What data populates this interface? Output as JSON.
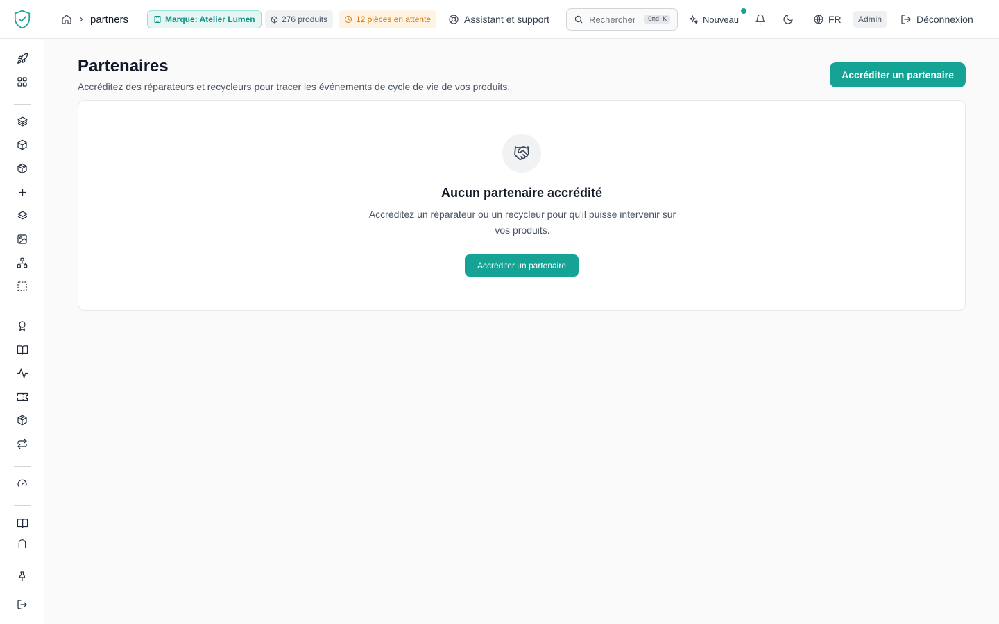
{
  "app": {
    "accent": "#14a394",
    "logo_icon": "shield-check-icon"
  },
  "header": {
    "breadcrumb": {
      "home_icon": "home-icon",
      "separator_icon": "chevron-right-icon",
      "current": "partners"
    },
    "brand_pill": {
      "label": "Marque: Atelier Lumen",
      "icon": "building-icon"
    },
    "products_pill": {
      "label": "276 produits",
      "icon": "box-icon"
    },
    "pending_pill": {
      "label": "12 pièces en attente",
      "icon": "clock-icon"
    },
    "support": {
      "label": "Assistant et support",
      "icon": "lifebuoy-icon"
    },
    "search": {
      "placeholder": "Rechercher",
      "shortcut": "Cmd K"
    },
    "new": {
      "label": "Nouveau",
      "icon": "sparkles-icon"
    },
    "notifications_icon": "bell-icon",
    "theme_icon": "moon-icon",
    "language": {
      "label": "FR",
      "icon": "globe-icon"
    },
    "role": "Admin",
    "logout": {
      "label": "Déconnexion",
      "icon": "logout-icon"
    }
  },
  "sidebar": {
    "icons": [
      "rocket-icon",
      "dashboard-icon",
      "layers-icon",
      "cube-icon",
      "cube-filled-icon",
      "plus-icon",
      "layers-stack-icon",
      "image-icon",
      "hierarchy-icon",
      "dashed-square-icon",
      "award-icon",
      "book-icon",
      "activity-icon",
      "ticket-icon",
      "package-icon",
      "repeat-icon",
      "gauge-icon",
      "book-open-icon",
      "arch-icon",
      "pin-icon",
      "logout-icon"
    ]
  },
  "page": {
    "title": "Partenaires",
    "subtitle": "Accréditez des réparateurs et recycleurs pour tracer les événements de cycle de vie de vos produits.",
    "primary_action": "Accréditer un partenaire"
  },
  "empty_state": {
    "icon": "handshake-icon",
    "title": "Aucun partenaire accrédité",
    "description": "Accréditez un réparateur ou un recycleur pour qu'il puisse intervenir sur vos produits.",
    "action": "Accréditer un partenaire"
  }
}
